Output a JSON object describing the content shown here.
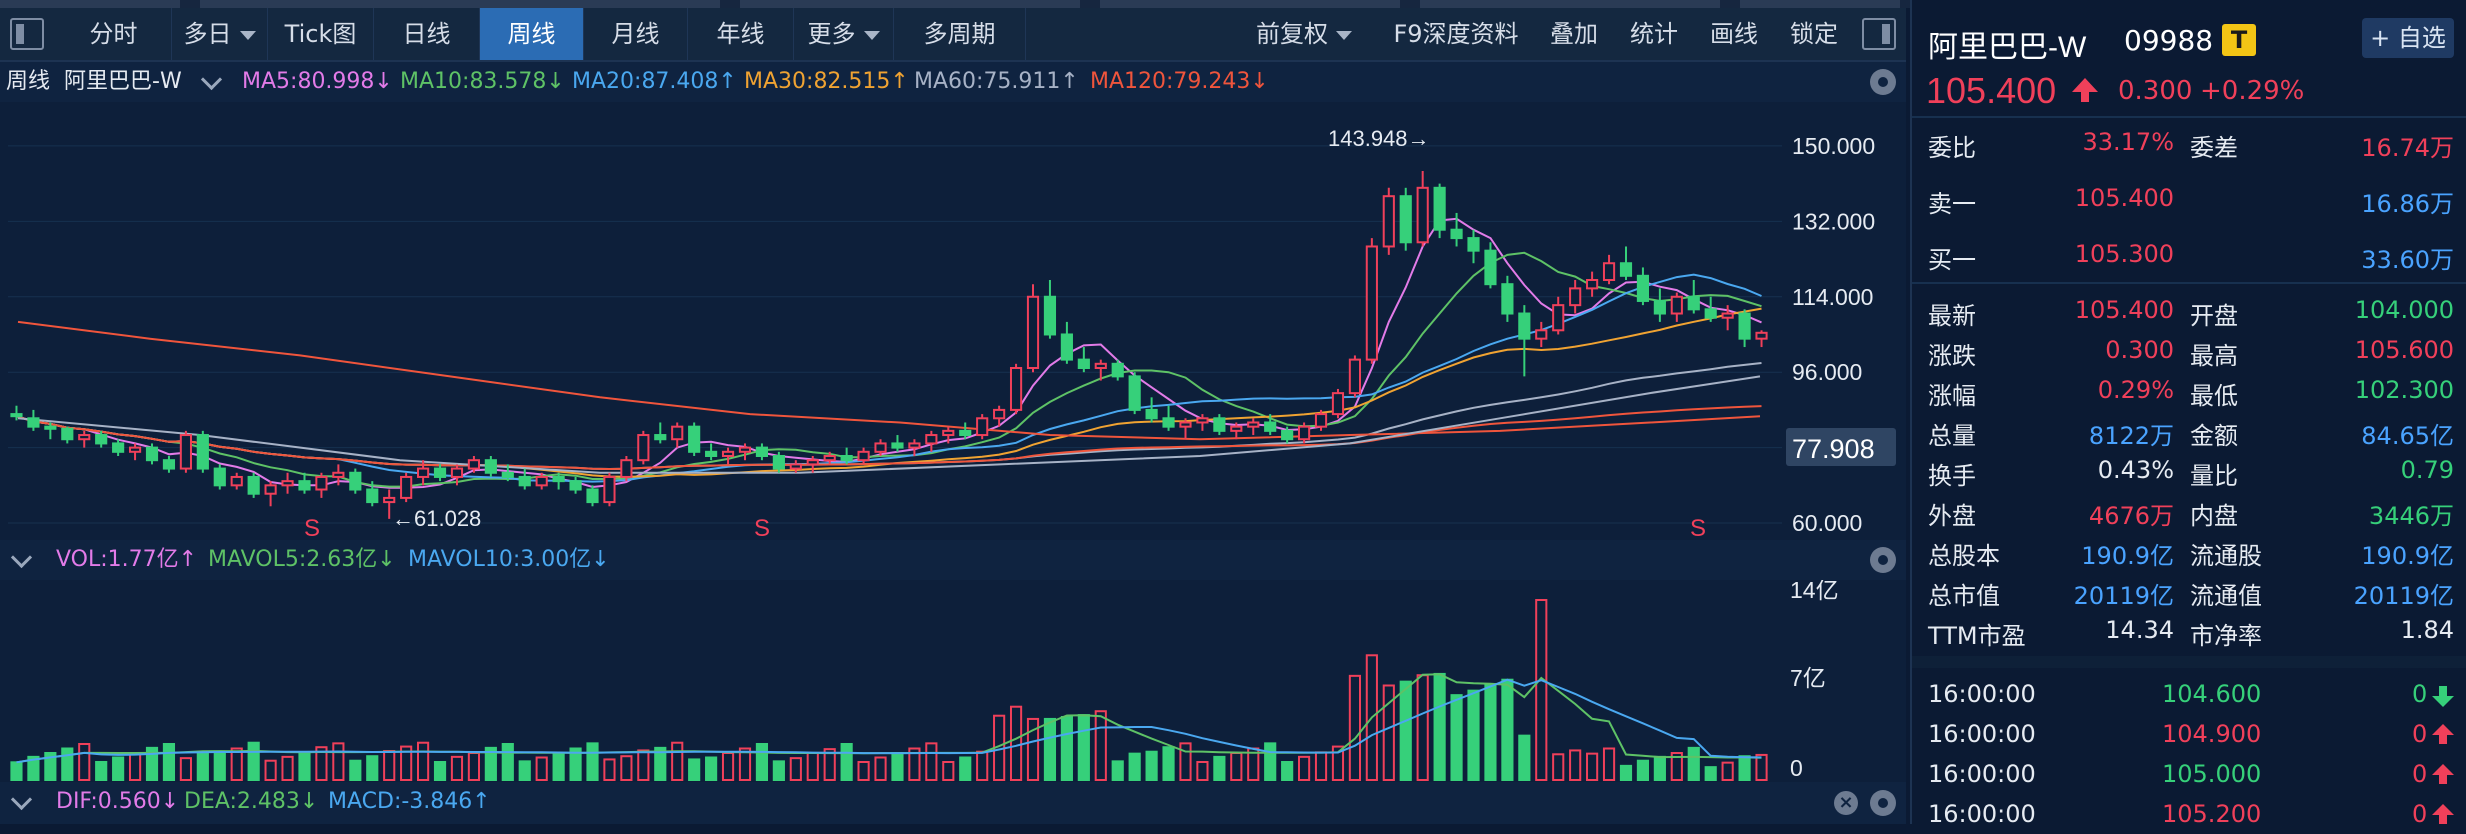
{
  "toolbar": {
    "tabs": [
      "分时",
      "多日",
      "Tick图",
      "日线",
      "周线",
      "月线",
      "年线",
      "更多",
      "多周期"
    ],
    "active_tab": "周线",
    "right_items": [
      "前复权",
      "F9深度资料",
      "叠加",
      "统计",
      "画线",
      "锁定"
    ]
  },
  "kline_header": {
    "period": "周线",
    "name": "阿里巴巴-W",
    "ma": [
      {
        "label": "MA5:80.998",
        "arrow": "↓",
        "color": "#e27be8"
      },
      {
        "label": "MA10:83.578",
        "arrow": "↓",
        "color": "#5ec266"
      },
      {
        "label": "MA20:87.408",
        "arrow": "↑",
        "color": "#4aa8f0"
      },
      {
        "label": "MA30:82.515",
        "arrow": "↑",
        "color": "#f0a332"
      },
      {
        "label": "MA60:75.911",
        "arrow": "↑",
        "color": "#a7b2c6"
      },
      {
        "label": "MA120:79.243",
        "arrow": "↓",
        "color": "#f0553c"
      }
    ]
  },
  "vol_header": [
    {
      "label": "VOL:1.77亿",
      "arrow": "↑",
      "color": "#e27be8"
    },
    {
      "label": "MAVOL5:2.63亿",
      "arrow": "↓",
      "color": "#5ec266"
    },
    {
      "label": "MAVOL10:3.00亿",
      "arrow": "↓",
      "color": "#4aa8f0"
    }
  ],
  "macd_header": [
    {
      "label": "DIF:0.560",
      "arrow": "↓",
      "color": "#e27be8"
    },
    {
      "label": "DEA:2.483",
      "arrow": "↓",
      "color": "#5ec266"
    },
    {
      "label": "MACD:-3.846",
      "arrow": "↑",
      "color": "#4aa8f0"
    }
  ],
  "annotations": {
    "high_label": "143.948→",
    "low_label": "←61.028",
    "signal": "S",
    "current_price_tag": "77.908"
  },
  "quote": {
    "name": "阿里巴巴-W",
    "code": "09988",
    "badge": "T",
    "add_btn": "+ 自选",
    "price": "105.400",
    "change": "0.300",
    "change_pct": "+0.29%",
    "bid_ask": [
      {
        "l": "委比",
        "v": "33.17%",
        "c": "red",
        "l2": "委差",
        "v2": "16.74万",
        "c2": "red"
      },
      {
        "l": "卖一",
        "v": "105.400",
        "c": "red",
        "v2": "16.86万",
        "c2": "blue"
      },
      {
        "l": "买一",
        "v": "105.300",
        "c": "red",
        "v2": "33.60万",
        "c2": "blue"
      }
    ],
    "stats": [
      {
        "l": "最新",
        "v": "105.400",
        "c": "red",
        "l2": "开盘",
        "v2": "104.000",
        "c2": "green"
      },
      {
        "l": "涨跌",
        "v": "0.300",
        "c": "red",
        "l2": "最高",
        "v2": "105.600",
        "c2": "red"
      },
      {
        "l": "涨幅",
        "v": "0.29%",
        "c": "red",
        "l2": "最低",
        "v2": "102.300",
        "c2": "green"
      },
      {
        "l": "总量",
        "v": "8122万",
        "c": "blue",
        "l2": "金额",
        "v2": "84.65亿",
        "c2": "blue"
      },
      {
        "l": "换手",
        "v": "0.43%",
        "c": "white",
        "l2": "量比",
        "v2": "0.79",
        "c2": "green"
      },
      {
        "l": "外盘",
        "v": "4676万",
        "c": "red",
        "l2": "内盘",
        "v2": "3446万",
        "c2": "green"
      },
      {
        "l": "总股本",
        "v": "190.9亿",
        "c": "blue",
        "l2": "流通股",
        "v2": "190.9亿",
        "c2": "blue"
      },
      {
        "l": "总市值",
        "v": "20119亿",
        "c": "blue",
        "l2": "流通值",
        "v2": "20119亿",
        "c2": "blue"
      },
      {
        "l": "TTM市盈",
        "v": "14.34",
        "c": "white",
        "l2": "市净率",
        "v2": "1.84",
        "c2": "white"
      }
    ],
    "ticks": [
      {
        "time": "16:00:00",
        "price": "104.600",
        "pc": "green",
        "vol": "0",
        "dir": "down"
      },
      {
        "time": "16:00:00",
        "price": "104.900",
        "pc": "red",
        "vol": "0",
        "dir": "up"
      },
      {
        "time": "16:00:00",
        "price": "105.000",
        "pc": "green",
        "vol": "0",
        "dir": "up"
      },
      {
        "time": "16:00:00",
        "price": "105.200",
        "pc": "red",
        "vol": "0",
        "dir": "up"
      }
    ]
  },
  "chart_data": {
    "type": "candlestick",
    "price_axis_ticks": [
      "150.000",
      "132.000",
      "114.000",
      "96.000",
      "60.000"
    ],
    "price_ylim": [
      60,
      150
    ],
    "volume_axis_ticks": [
      "14亿",
      "7亿",
      "0"
    ],
    "candles": [
      [
        86,
        88,
        84.5,
        85.5
      ],
      [
        85,
        87,
        82,
        83
      ],
      [
        83,
        84,
        80,
        82.5
      ],
      [
        82.5,
        83,
        79,
        80
      ],
      [
        80,
        82,
        78,
        81
      ],
      [
        81,
        82,
        78,
        79
      ],
      [
        79,
        80,
        76,
        77
      ],
      [
        77,
        79,
        75,
        78
      ],
      [
        78,
        79,
        74,
        75
      ],
      [
        75,
        76,
        72,
        73
      ],
      [
        73,
        82,
        72,
        81
      ],
      [
        81,
        82,
        72,
        73
      ],
      [
        73,
        74,
        68,
        69
      ],
      [
        69,
        72,
        68,
        71
      ],
      [
        71,
        72,
        66,
        67
      ],
      [
        67,
        70,
        64,
        69
      ],
      [
        69,
        72,
        67,
        70
      ],
      [
        70,
        72,
        67,
        68
      ],
      [
        68,
        72,
        66,
        71
      ],
      [
        71,
        74,
        69,
        72
      ],
      [
        72,
        73,
        67,
        68
      ],
      [
        68,
        70,
        64,
        65
      ],
      [
        65,
        68,
        61,
        66
      ],
      [
        66,
        72,
        65,
        71
      ],
      [
        71,
        75,
        69,
        73
      ],
      [
        73,
        74,
        70,
        71
      ],
      [
        71,
        74,
        69,
        73
      ],
      [
        73,
        76,
        72,
        75
      ],
      [
        75,
        76,
        71,
        72
      ],
      [
        72,
        74,
        70,
        71
      ],
      [
        71,
        73,
        68,
        69
      ],
      [
        69,
        72,
        68,
        71
      ],
      [
        71,
        72,
        68,
        70
      ],
      [
        70,
        71,
        67,
        68
      ],
      [
        68,
        69,
        64,
        65
      ],
      [
        65,
        72,
        64,
        71
      ],
      [
        71,
        76,
        70,
        75
      ],
      [
        75,
        82,
        74,
        81
      ],
      [
        81,
        84,
        79,
        80
      ],
      [
        80,
        84,
        78,
        83
      ],
      [
        83,
        84,
        76,
        77
      ],
      [
        77,
        79,
        75,
        76
      ],
      [
        76,
        78,
        74,
        77
      ],
      [
        77,
        79,
        75,
        78
      ],
      [
        78,
        79,
        75,
        76
      ],
      [
        76,
        77,
        72,
        73
      ],
      [
        73,
        75,
        72,
        74
      ],
      [
        74,
        76,
        72,
        75
      ],
      [
        75,
        77,
        74,
        76
      ],
      [
        76,
        78,
        74,
        75
      ],
      [
        75,
        78,
        74,
        77
      ],
      [
        77,
        80,
        76,
        79
      ],
      [
        79,
        81,
        77,
        78
      ],
      [
        78,
        80,
        76,
        79
      ],
      [
        79,
        82,
        77,
        81
      ],
      [
        81,
        83,
        79,
        82
      ],
      [
        82,
        84,
        80,
        81
      ],
      [
        81,
        86,
        80,
        85
      ],
      [
        85,
        88,
        83,
        87
      ],
      [
        87,
        98,
        86,
        97
      ],
      [
        97,
        117,
        96,
        114
      ],
      [
        114,
        118,
        104,
        105
      ],
      [
        105,
        108,
        98,
        99
      ],
      [
        99,
        102,
        96,
        97
      ],
      [
        97,
        99,
        94,
        98
      ],
      [
        98,
        99,
        94,
        95
      ],
      [
        95,
        96,
        86,
        87
      ],
      [
        87,
        90,
        84,
        85
      ],
      [
        85,
        88,
        82,
        83
      ],
      [
        83,
        85,
        80,
        84
      ],
      [
        84,
        86,
        82,
        85
      ],
      [
        85,
        86,
        81,
        82
      ],
      [
        82,
        84,
        80,
        83
      ],
      [
        83,
        85,
        81,
        84
      ],
      [
        84,
        86,
        81,
        82
      ],
      [
        82,
        83,
        79,
        80
      ],
      [
        80,
        84,
        79,
        83
      ],
      [
        83,
        87,
        82,
        86
      ],
      [
        86,
        92,
        85,
        91
      ],
      [
        91,
        100,
        90,
        99
      ],
      [
        99,
        128,
        98,
        126
      ],
      [
        126,
        140,
        124,
        138
      ],
      [
        138,
        140,
        125,
        127
      ],
      [
        127,
        144,
        126,
        140
      ],
      [
        140,
        141,
        128,
        130
      ],
      [
        130,
        134,
        126,
        128
      ],
      [
        128,
        130,
        122,
        125
      ],
      [
        125,
        127,
        116,
        117
      ],
      [
        117,
        119,
        108,
        110
      ],
      [
        110,
        112,
        95,
        104
      ],
      [
        104,
        108,
        102,
        106
      ],
      [
        106,
        114,
        105,
        112
      ],
      [
        112,
        118,
        110,
        116
      ],
      [
        116,
        120,
        114,
        118
      ],
      [
        118,
        124,
        117,
        122
      ],
      [
        122,
        126,
        118,
        119
      ],
      [
        119,
        121,
        112,
        113
      ],
      [
        113,
        116,
        108,
        110
      ],
      [
        110,
        115,
        108,
        114
      ],
      [
        114,
        118,
        110,
        111
      ],
      [
        111,
        114,
        108,
        109
      ],
      [
        109,
        112,
        106,
        110
      ],
      [
        110,
        111,
        102,
        104
      ],
      [
        104,
        106,
        102,
        105.4
      ]
    ],
    "ma_colors": [
      "#e27be8",
      "#5ec266",
      "#4aa8f0",
      "#f0a332",
      "#a7b2c6",
      "#f0553c"
    ]
  }
}
